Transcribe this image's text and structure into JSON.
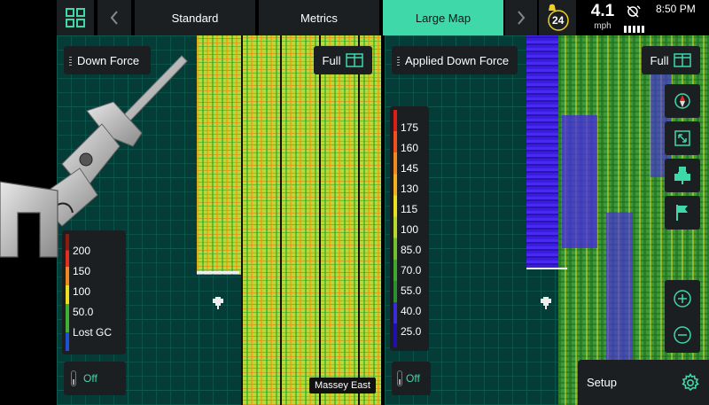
{
  "topbar": {
    "tabs": [
      {
        "label": "Standard",
        "active": false
      },
      {
        "label": "Metrics",
        "active": false
      },
      {
        "label": "Large Map",
        "active": true
      }
    ],
    "alert_count": "24",
    "speed": {
      "value": "4.1",
      "unit": "mph"
    },
    "clock": "8:50 PM"
  },
  "left_map": {
    "layer_label": "Down Force",
    "view_label": "Full",
    "legend": {
      "labels": [
        "200",
        "150",
        "100",
        "50.0",
        "Lost GC"
      ],
      "colors": [
        "#8b1a10",
        "#e03020",
        "#f08a20",
        "#e8e020",
        "#40b030",
        "#2050d0"
      ]
    },
    "toggle_label": "Off",
    "field_name": "Massey East"
  },
  "right_map": {
    "layer_label": "Applied Down Force",
    "view_label": "Full",
    "legend": {
      "labels": [
        "175",
        "160",
        "145",
        "130",
        "115",
        "100",
        "85.0",
        "70.0",
        "55.0",
        "40.0",
        "25.0"
      ],
      "colors": [
        "#d82018",
        "#f05020",
        "#f08a20",
        "#f0b020",
        "#e8e020",
        "#b8d830",
        "#70c030",
        "#40a830",
        "#2a9030",
        "#3a2ad8",
        "#2010b0"
      ]
    },
    "toggle_label": "Off",
    "setup_label": "Setup",
    "side_buttons": [
      "compass-icon",
      "fit-view-icon",
      "tractor-icon",
      "flag-icon",
      "zoom-in-icon",
      "zoom-out-icon"
    ]
  },
  "colors": {
    "accent": "#3fd8a8",
    "panel": "#1c1f22"
  }
}
